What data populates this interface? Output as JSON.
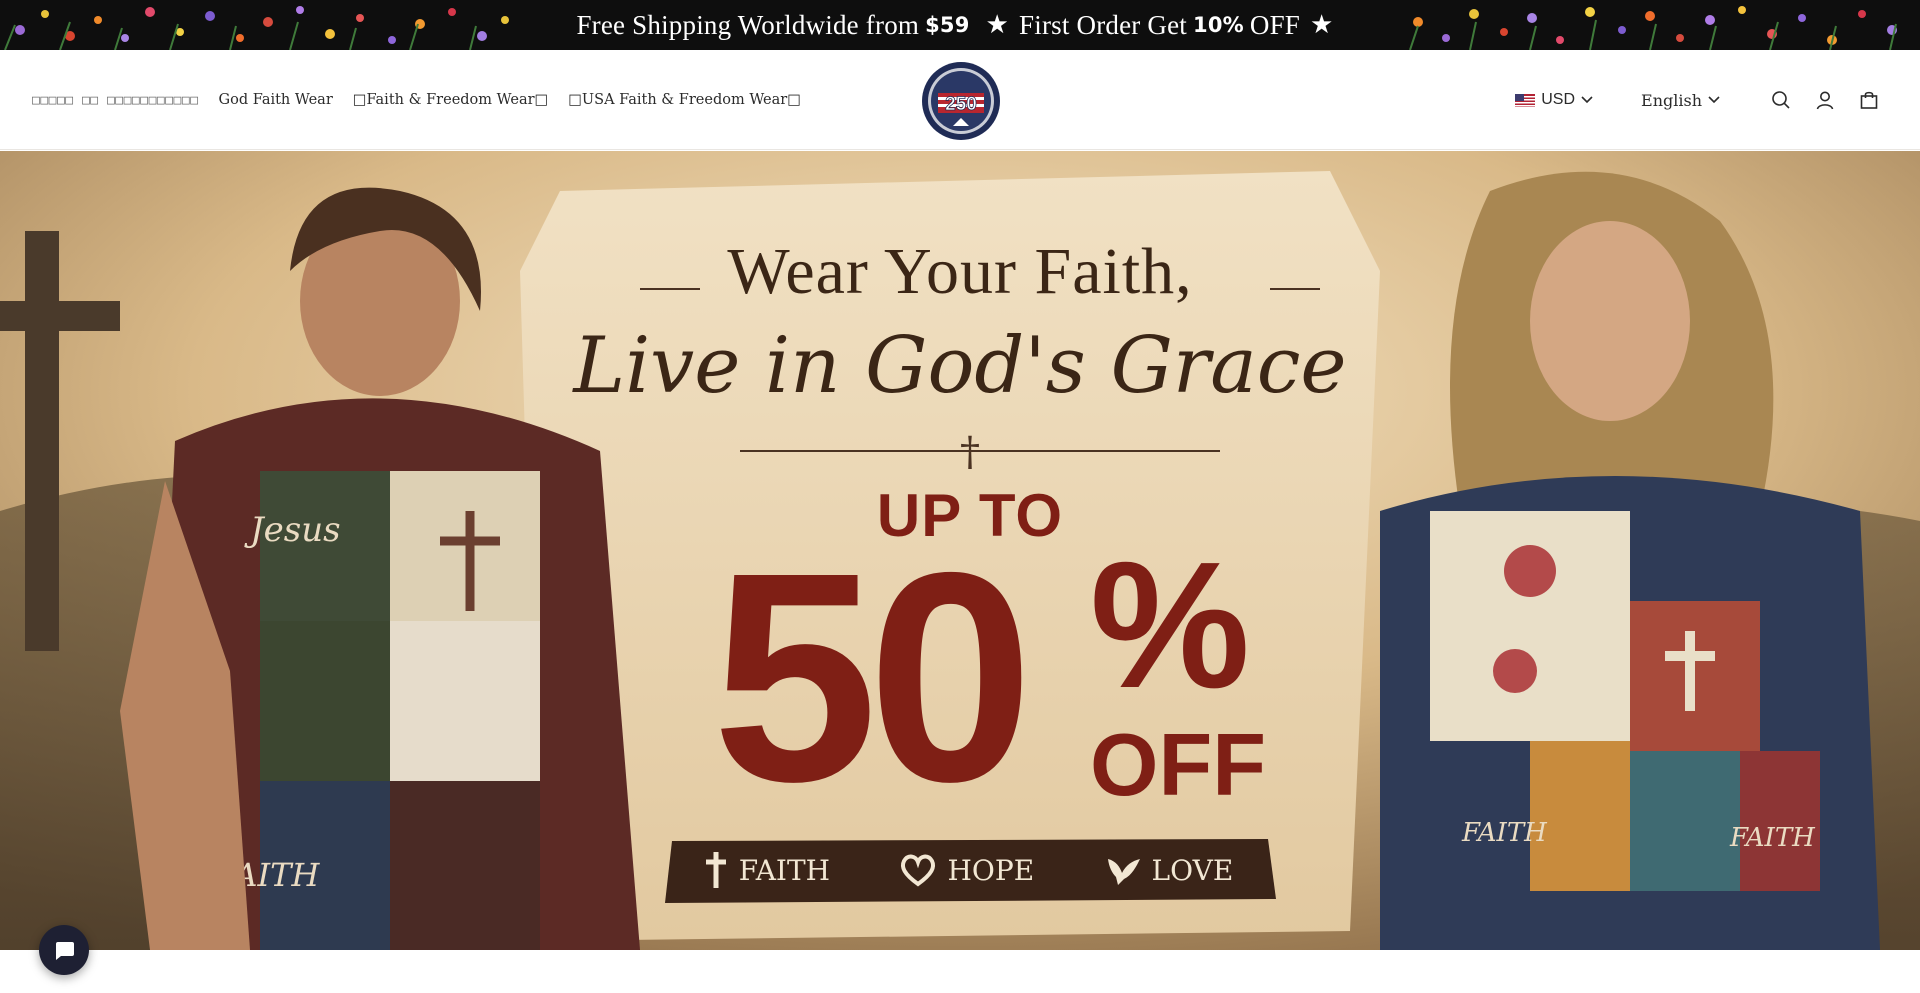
{
  "announcement": {
    "part1": "Free Shipping Worldwide from",
    "amount": "$59",
    "star": "★",
    "part2": "First Order Get",
    "discount": "10%",
    "part3": "OFF"
  },
  "nav": {
    "items": [
      {
        "label": "□□□□□ □□ □□□□□□□□□□□",
        "muted": true
      },
      {
        "label": "God Faith Wear"
      },
      {
        "label": "□Faith & Freedom Wear□"
      },
      {
        "label": "□USA Faith & Freedom Wear□"
      }
    ]
  },
  "logo": {
    "text_top": "usafreedom1776",
    "number": "250"
  },
  "tools": {
    "currency": "USD",
    "language": "English",
    "icons": [
      "search-icon",
      "account-icon",
      "cart-icon"
    ]
  },
  "hero": {
    "headline1": "Wear Your Faith,",
    "headline2": "Live in God's Grace",
    "up_to": "UP TO",
    "number": "50",
    "percent": "%",
    "off": "OFF",
    "values": [
      "FAITH",
      "HOPE",
      "LOVE"
    ],
    "shirt_text_left": [
      "Jesus",
      "FAITH"
    ],
    "shirt_text_right": [
      "FAITH",
      "FAITH"
    ]
  },
  "colors": {
    "announcement_bg": "#0e0e0e",
    "accent_red": "#7f1f15",
    "headline_brown": "#3b2616",
    "band_dark": "#3a2418",
    "chat_bg": "#1e2033"
  }
}
